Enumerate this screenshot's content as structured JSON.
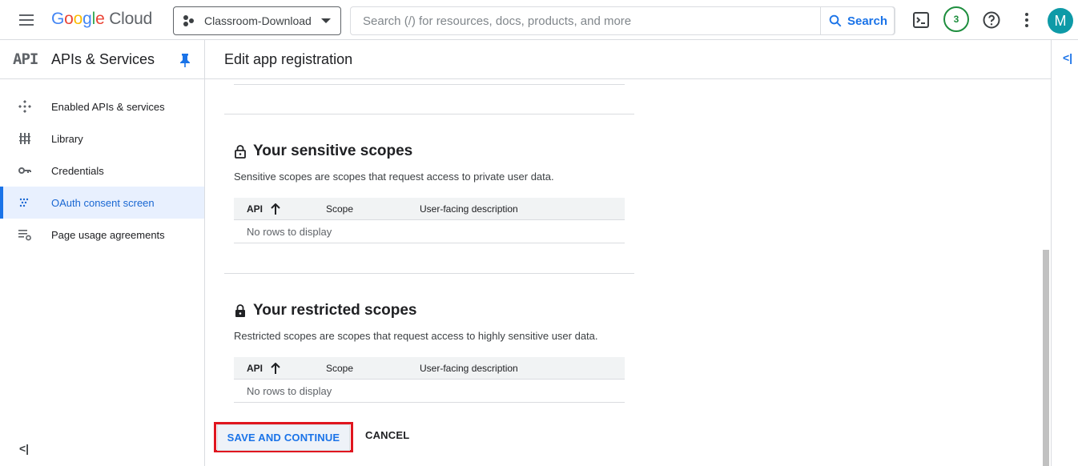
{
  "header": {
    "logo_letters": [
      "G",
      "o",
      "o",
      "g",
      "l",
      "e"
    ],
    "logo_cloud": "Cloud",
    "project_name": "Classroom-Download",
    "search_placeholder": "Search (/) for resources, docs, products, and more",
    "search_button_label": "Search",
    "notifications_count": "3",
    "avatar_initial": "M"
  },
  "sidebar": {
    "logo_text": "API",
    "title": "APIs & Services",
    "items": [
      {
        "label": "Enabled APIs & services",
        "icon": "diamond-dots-icon",
        "active": false
      },
      {
        "label": "Library",
        "icon": "library-icon",
        "active": false
      },
      {
        "label": "Credentials",
        "icon": "key-icon",
        "active": false
      },
      {
        "label": "OAuth consent screen",
        "icon": "consent-dots-icon",
        "active": true
      },
      {
        "label": "Page usage agreements",
        "icon": "list-settings-icon",
        "active": false
      }
    ],
    "collapse_label": "<|"
  },
  "main": {
    "page_title": "Edit app registration",
    "sensitive": {
      "title": "Your sensitive scopes",
      "description": "Sensitive scopes are scopes that request access to private user data.",
      "columns": [
        "API",
        "Scope",
        "User-facing description"
      ],
      "empty_text": "No rows to display"
    },
    "restricted": {
      "title": "Your restricted scopes",
      "description": "Restricted scopes are scopes that request access to highly sensitive user data.",
      "columns": [
        "API",
        "Scope",
        "User-facing description"
      ],
      "empty_text": "No rows to display"
    },
    "save_label": "SAVE AND CONTINUE",
    "cancel_label": "CANCEL"
  },
  "right_rail": {
    "toggle_label": "<|"
  },
  "colors": {
    "accent": "#1a73e8",
    "highlight_border": "#e0161f",
    "active_bg": "#e8f0fe"
  }
}
